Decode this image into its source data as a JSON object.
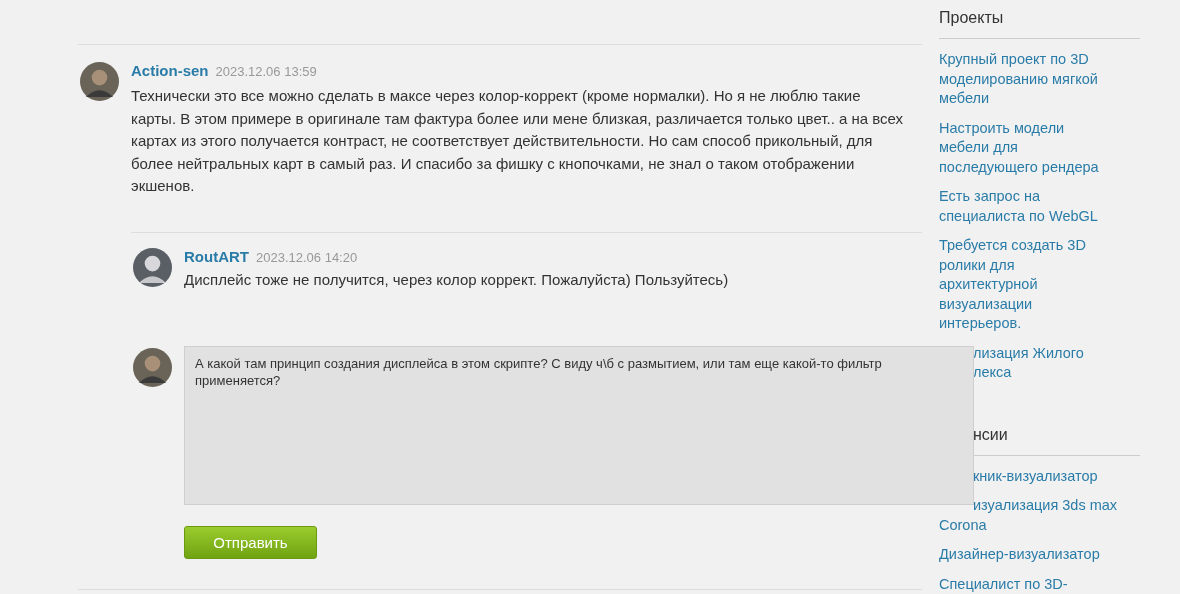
{
  "comments": [
    {
      "author": "Action-sen",
      "date": "2023.12.06 13:59",
      "text": "Технически это все можно сделать в максе через колор-коррект (кроме нормалки). Но я не люблю такие карты. В этом примере в оригинале там фактура более или мене близкая, различается только цвет.. а на всех картах из этого получается контраст, не соответствует действительности. Но сам способ прикольный, для более нейтральных карт в самый раз. И спасибо за фишку с кнопочками, не знал о таком отображении экшенов.",
      "children": [
        {
          "author": "RoutART",
          "date": "2023.12.06 14:20",
          "text": "Дисплейс тоже не получится, через колор коррект. Пожалуйста) Пользуйтесь)"
        }
      ]
    }
  ],
  "reply_form": {
    "value": "А какой там принцип создания дисплейса в этом скрипте? С виду ч\\б с размытием, или там еще какой-то фильтр применяется?",
    "button": "Отправить"
  },
  "sidebar": [
    {
      "title": "Проекты",
      "title_clipped": false,
      "items": [
        {
          "text": "Крупный проект по 3D моделированию мягкой мебели"
        },
        {
          "text": "Настроить модели мебели для последующего рендера"
        },
        {
          "text": "Есть запрос на специалиста по WebGL"
        },
        {
          "text": "Требуется создать 3D ролики для архитектурной визуализации интерьеров."
        },
        {
          "lines": [
            {
              "text": "лизация Жилого",
              "clipped": true
            },
            {
              "text": "лекса",
              "clipped": true
            }
          ]
        }
      ]
    },
    {
      "title": "нсии",
      "title_clipped": true,
      "items": [
        {
          "lines": [
            {
              "text": "кник-визуализатор",
              "clipped": true
            }
          ]
        },
        {
          "lines": [
            {
              "text": "изуализация 3ds max",
              "clipped": true
            },
            {
              "text": "Corona"
            }
          ]
        },
        {
          "text": "Дизайнер-визуализатор"
        },
        {
          "text": "Специалист по 3D-"
        }
      ]
    }
  ]
}
